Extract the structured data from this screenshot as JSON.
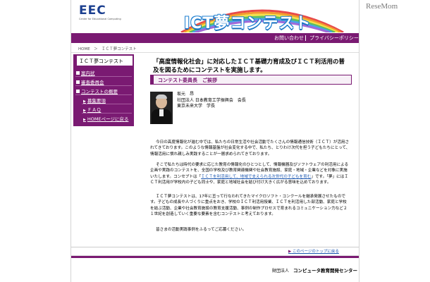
{
  "watermark": "ReseMom",
  "header": {
    "logo": "EEC",
    "logo_subtitle": "Center for Educational Computing",
    "title": "ICT夢コンテスト"
  },
  "nav": {
    "contact": "お問い合わせ",
    "privacy": "プライバシーポリシー"
  },
  "breadcrumb": "HOME　＞　ＩＣＴ夢コンテスト",
  "sidebar": {
    "title": "ＩＣＴ夢コンテスト",
    "items": [
      {
        "label": "案内状"
      },
      {
        "label": "審査委員会"
      },
      {
        "label": "コンテストの概要"
      }
    ],
    "subitems": [
      {
        "label": "募集要項"
      },
      {
        "label": "ＦＡＱ"
      },
      {
        "label": "HOMEページに戻る"
      }
    ]
  },
  "main": {
    "heading": "「高度情報化社会」に対応したＩＣＴ基礎力育成及びＩＣＴ利活用の普及を図るためにコンテストを実施します。",
    "section_title": "コンテスト委員長　ご挨拶",
    "profile": {
      "name": "坂元　昂",
      "line1": "社団法人 日本教育工学振興会　会長",
      "line2": "東京未来大学　学長"
    },
    "para1": "今日の高度情報化が進む中では、私たちの日常生活や社会活動でたくさんの情報通信技術（ＩＣＴ）が活用されてきております。このような情報基盤が社会変化する中で、私たち、とりわけ次代を担う子どもたちにとって、情報活用に慣れ親しみ実践することが一層求められてきております。",
    "para2a": "そこで私たちは時代の要求に応じた教育の情報化のひとつとして、情報機器及びソフトウェアの利活用による企画や実践のコンテストを、全国の学校及び教育関連機関や社会教育施設、家庭・地域・企業などを対象に実施いたします。コンセプトは「",
    "para2_hl1": "ＩＣＴを利活用して、地域で支えられる次世代の子どもを育む",
    "para2b": "」です。「夢」にはＩＣＴ利活用が学校内の子ども同士や、家庭と地域社会を結び付け大きく広がる意味を込めております。",
    "para3": "ＩＣＴ夢コンテストは、17年に亘って行なわれてきたマイクロソフト・コンクールを継承発展させたものです。子どもの成長や人づくりに重点をおき、学校のＩＣＴ利活用授業、ＩＣＴを利活用した部活動、家庭と学校を結ぶ活動、企業や社会教育施設の教育支援活動、事例の制作プロセスで育まれるコミュニケーション力など２１世紀を創造していく重要な要素を含むコンテストと考えております。",
    "para4": "皆さまの活動実践事例をふるってご応募ください。",
    "to_top": "このページのトップに戻る"
  },
  "footer": {
    "prefix": "財団法人",
    "org": "コンピュータ教育開発センター"
  },
  "colors": {
    "brand_purple": "#7a1a72",
    "link_blue": "#1a56b0"
  }
}
